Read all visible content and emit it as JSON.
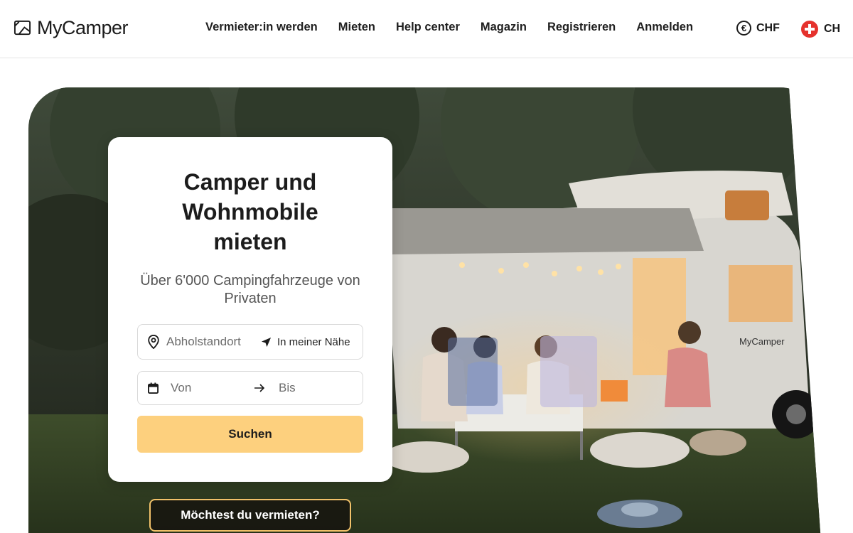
{
  "header": {
    "logo_text": "MyCamper",
    "nav": [
      {
        "label": "Vermieter:in werden"
      },
      {
        "label": "Mieten"
      },
      {
        "label": "Help center"
      },
      {
        "label": "Magazin"
      },
      {
        "label": "Registrieren"
      },
      {
        "label": "Anmelden"
      }
    ],
    "currency": {
      "symbol": "€",
      "label": "CHF",
      "icon": "euro-icon"
    },
    "country": {
      "label": "CH",
      "icon": "swiss-flag-icon",
      "color": "#e5322d"
    }
  },
  "hero": {
    "image_description": "camping-family-at-motorhome-evening",
    "van_logo_text": "MyCamper"
  },
  "search_card": {
    "title": "Camper und Wohnmobile mieten",
    "subtitle": "Über 6'000 Campingfahrzeuge von Privaten",
    "location": {
      "placeholder": "Abholstandort",
      "icon": "location-pin-icon"
    },
    "nearby": {
      "label": "In meiner Nähe",
      "icon": "navigation-arrow-icon"
    },
    "dates": {
      "from_placeholder": "Von",
      "to_placeholder": "Bis",
      "icon": "calendar-icon"
    },
    "search_button": "Suchen",
    "accent_color": "#fdd07e"
  },
  "rent_out_button": "Möchtest du vermieten?"
}
